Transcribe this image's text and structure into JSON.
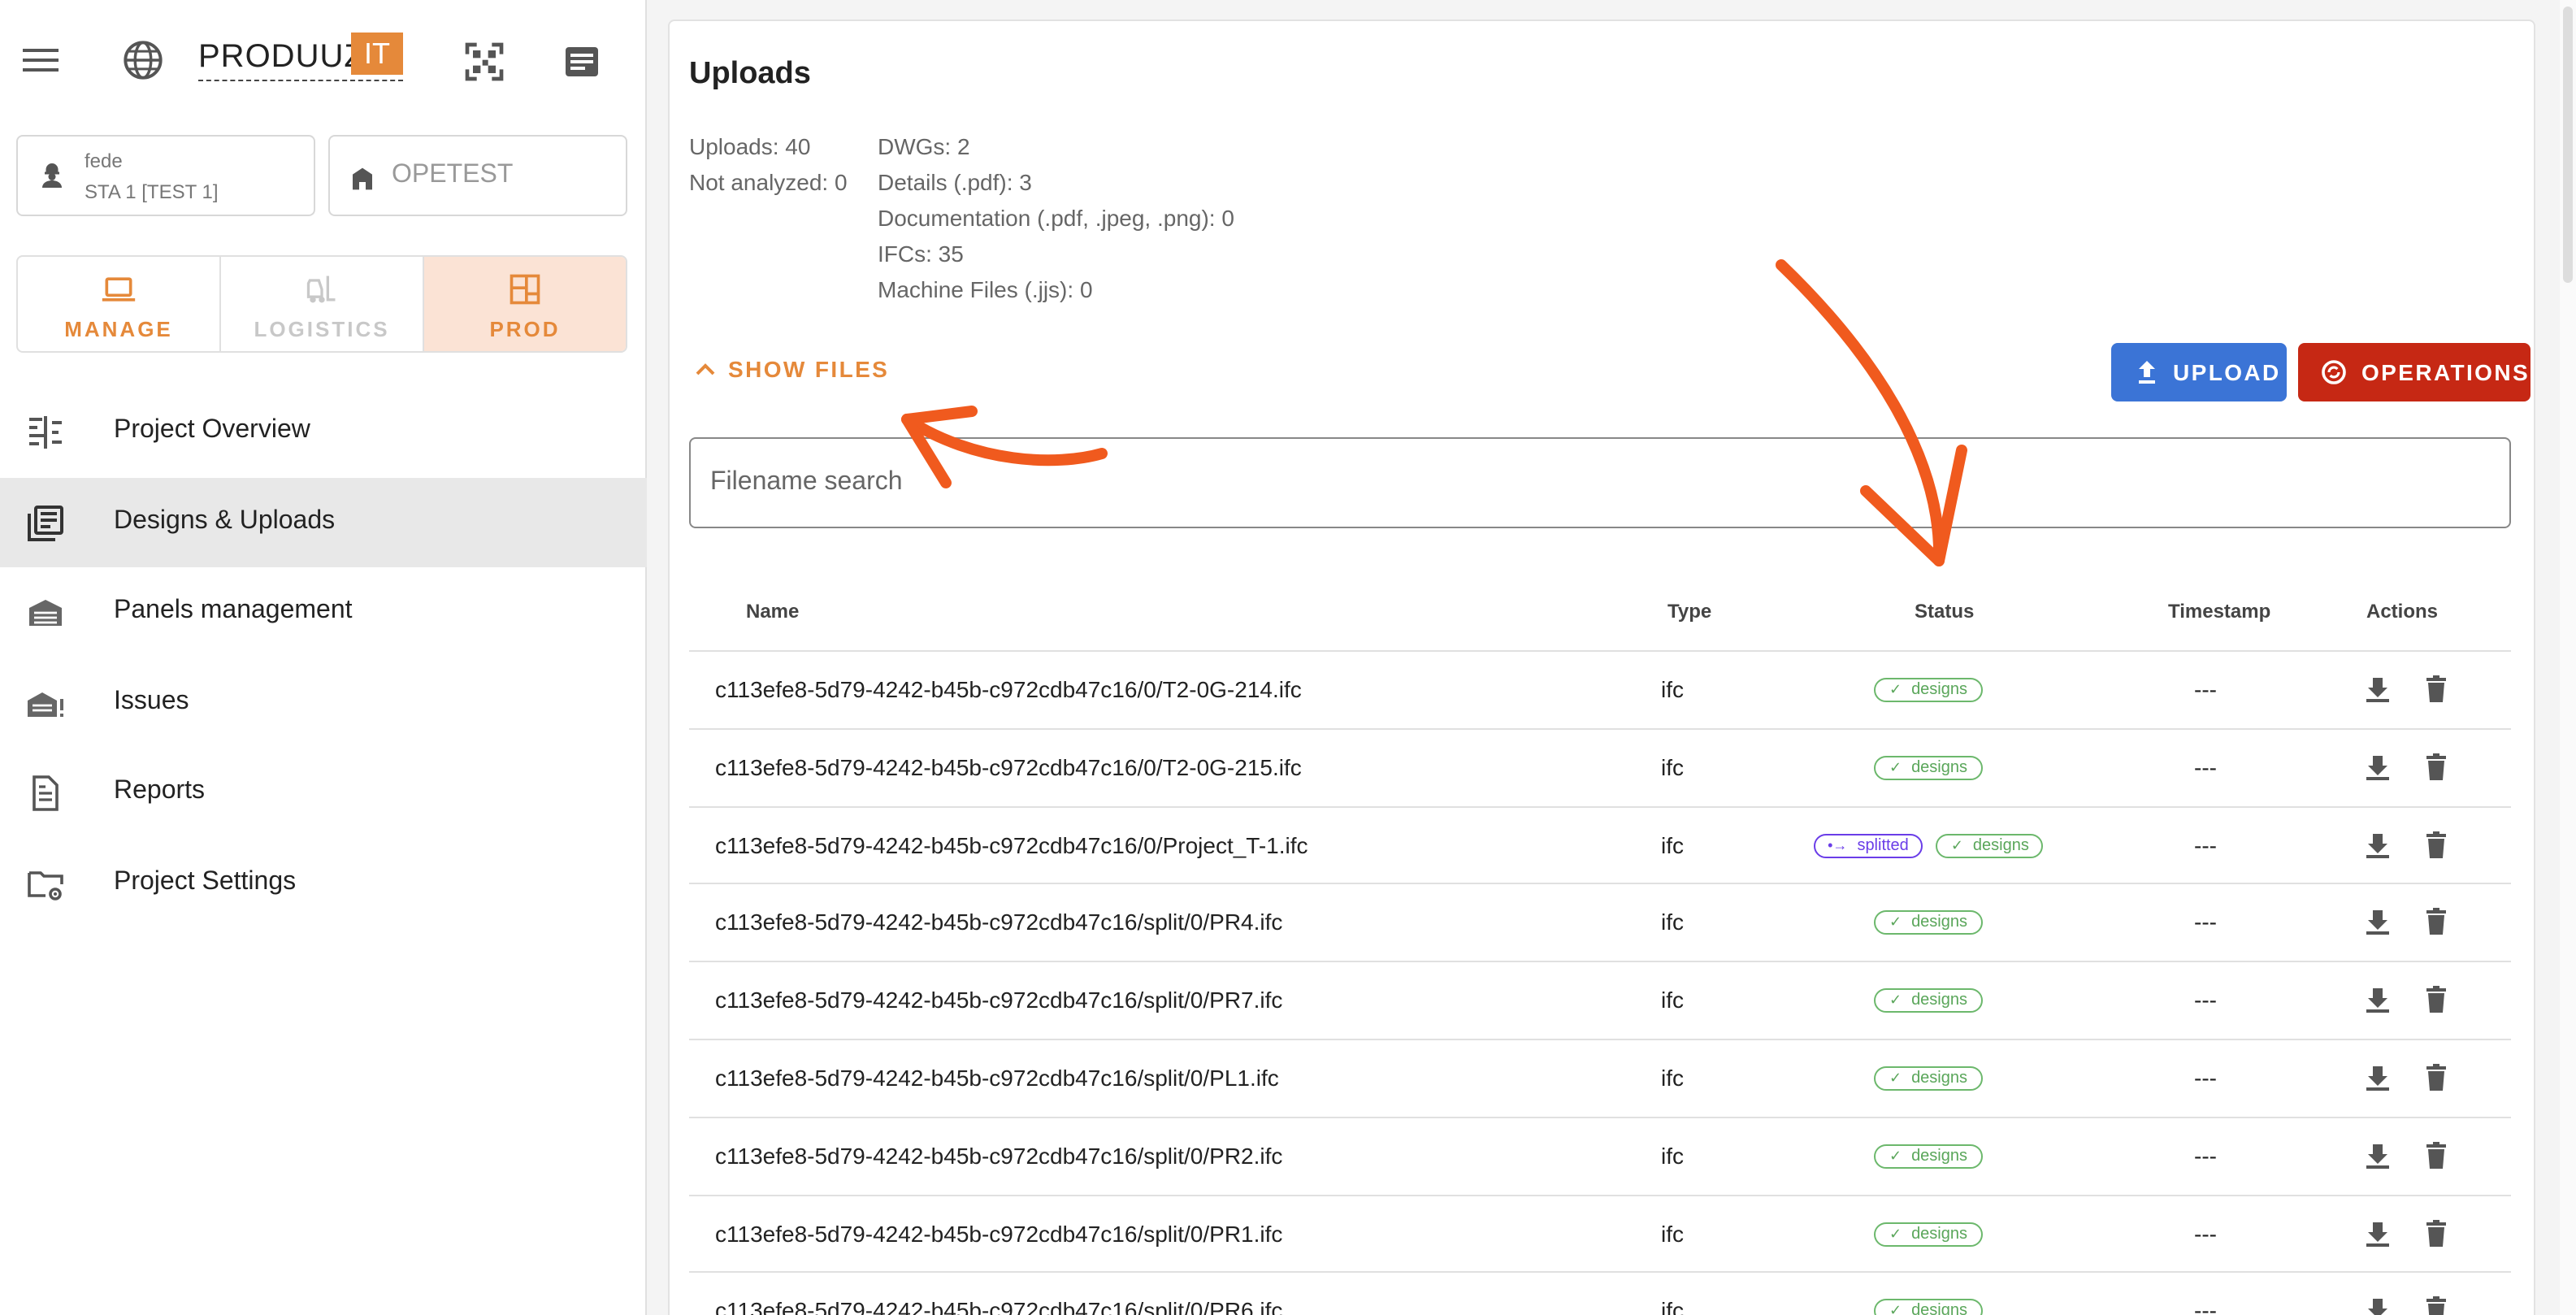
{
  "brand": {
    "logo_text": "PRODUUZ",
    "logo_highlight": "IT"
  },
  "user": {
    "name": "fede",
    "station": "STA 1 [TEST 1]"
  },
  "project": {
    "name": "OPETEST"
  },
  "modes": [
    {
      "label": "MANAGE"
    },
    {
      "label": "LOGISTICS"
    },
    {
      "label": "PROD"
    }
  ],
  "nav": [
    {
      "label": "Project Overview"
    },
    {
      "label": "Designs & Uploads"
    },
    {
      "label": "Panels management"
    },
    {
      "label": "Issues"
    },
    {
      "label": "Reports"
    },
    {
      "label": "Project Settings"
    }
  ],
  "main": {
    "title": "Uploads",
    "stats_left": [
      "Uploads: 40",
      "Not analyzed: 0"
    ],
    "stats_right": [
      "DWGs: 2",
      "Details (.pdf): 3",
      "Documentation (.pdf, .jpeg, .png): 0",
      "IFCs: 35",
      "Machine Files (.jjs): 0"
    ],
    "show_files": "SHOW FILES",
    "upload_label": "UPLOAD",
    "operations_label": "OPERATIONS",
    "search_placeholder": "Filename search"
  },
  "table": {
    "headers": {
      "name": "Name",
      "type": "Type",
      "status": "Status",
      "timestamp": "Timestamp",
      "actions": "Actions"
    },
    "rows": [
      {
        "name": "c113efe8-5d79-4242-b45b-c972cdb47c16/0/T2-0G-214.ifc",
        "type": "ifc",
        "statuses": [
          "designs"
        ],
        "timestamp": "---"
      },
      {
        "name": "c113efe8-5d79-4242-b45b-c972cdb47c16/0/T2-0G-215.ifc",
        "type": "ifc",
        "statuses": [
          "designs"
        ],
        "timestamp": "---"
      },
      {
        "name": "c113efe8-5d79-4242-b45b-c972cdb47c16/0/Project_T-1.ifc",
        "type": "ifc",
        "statuses": [
          "splitted",
          "designs"
        ],
        "timestamp": "---"
      },
      {
        "name": "c113efe8-5d79-4242-b45b-c972cdb47c16/split/0/PR4.ifc",
        "type": "ifc",
        "statuses": [
          "designs"
        ],
        "timestamp": "---"
      },
      {
        "name": "c113efe8-5d79-4242-b45b-c972cdb47c16/split/0/PR7.ifc",
        "type": "ifc",
        "statuses": [
          "designs"
        ],
        "timestamp": "---"
      },
      {
        "name": "c113efe8-5d79-4242-b45b-c972cdb47c16/split/0/PL1.ifc",
        "type": "ifc",
        "statuses": [
          "designs"
        ],
        "timestamp": "---"
      },
      {
        "name": "c113efe8-5d79-4242-b45b-c972cdb47c16/split/0/PR2.ifc",
        "type": "ifc",
        "statuses": [
          "designs"
        ],
        "timestamp": "---"
      },
      {
        "name": "c113efe8-5d79-4242-b45b-c972cdb47c16/split/0/PR1.ifc",
        "type": "ifc",
        "statuses": [
          "designs"
        ],
        "timestamp": "---"
      },
      {
        "name": "c113efe8-5d79-4242-b45b-c972cdb47c16/split/0/PR6.ifc",
        "type": "ifc",
        "statuses": [
          "designs"
        ],
        "timestamp": "---"
      }
    ]
  },
  "colors": {
    "accent": "#e5893a",
    "upload": "#3b74d6",
    "operations": "#c62814",
    "annotation_arrow": "#f05a1e"
  }
}
